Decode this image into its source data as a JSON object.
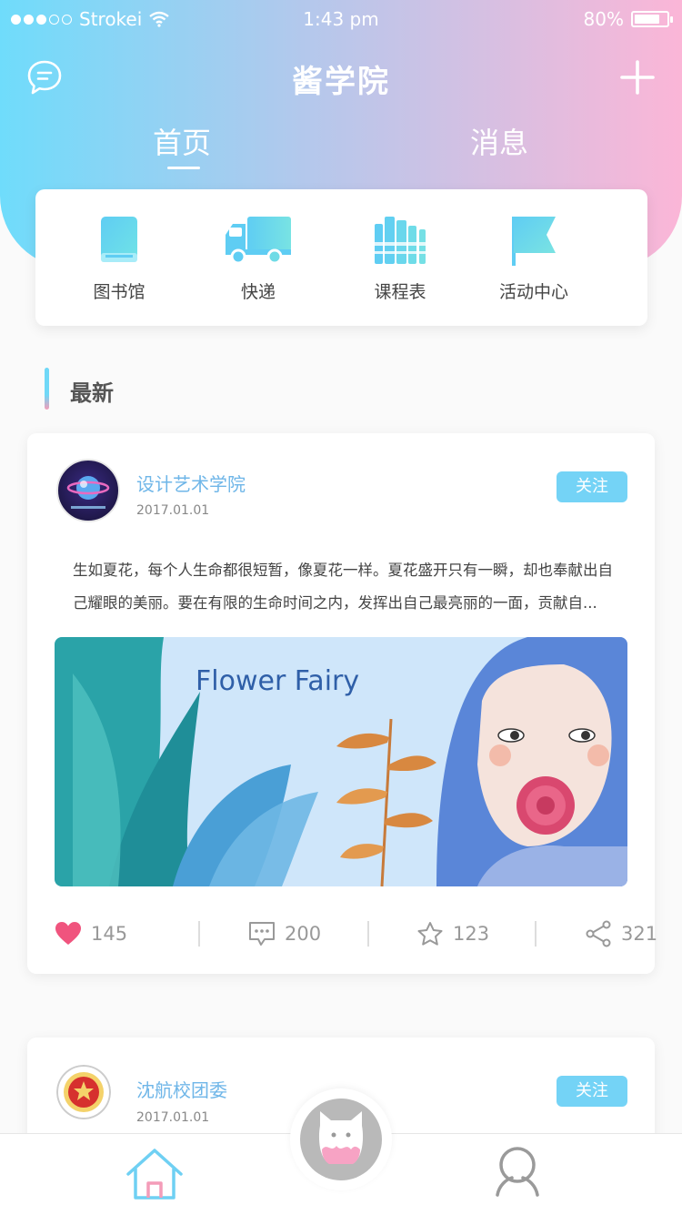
{
  "status_bar": {
    "carrier": "Strokei",
    "time": "1:43 pm",
    "battery": "80%",
    "battery_level": 0.8
  },
  "header": {
    "title": "酱学院",
    "tabs": [
      {
        "label": "首页"
      },
      {
        "label": "消息"
      }
    ]
  },
  "quick_actions": [
    {
      "label": "图书馆",
      "icon": "book-icon"
    },
    {
      "label": "快递",
      "icon": "truck-icon"
    },
    {
      "label": "课程表",
      "icon": "books-icon"
    },
    {
      "label": "活动中心",
      "icon": "flag-icon"
    }
  ],
  "section": {
    "title": "最新"
  },
  "posts": [
    {
      "author": "设计艺术学院",
      "date": "2017.01.01",
      "follow_label": "关注",
      "text": "生如夏花，每个人生命都很短暂，像夏花一样。夏花盛开只有一瞬，却也奉献出自己耀眼的美丽。要在有限的生命时间之内，发挥出自己最亮丽的一面，贡献自...",
      "image_caption": "Flower Fairy",
      "likes": "145",
      "comments": "200",
      "favorites": "123",
      "shares": "321"
    },
    {
      "author": "沈航校团委",
      "date": "2017.01.01",
      "follow_label": "关注"
    }
  ],
  "colors": {
    "accent_blue": "#74d3f6",
    "accent_pink": "#fbb6d7",
    "like_red": "#f0547e"
  }
}
